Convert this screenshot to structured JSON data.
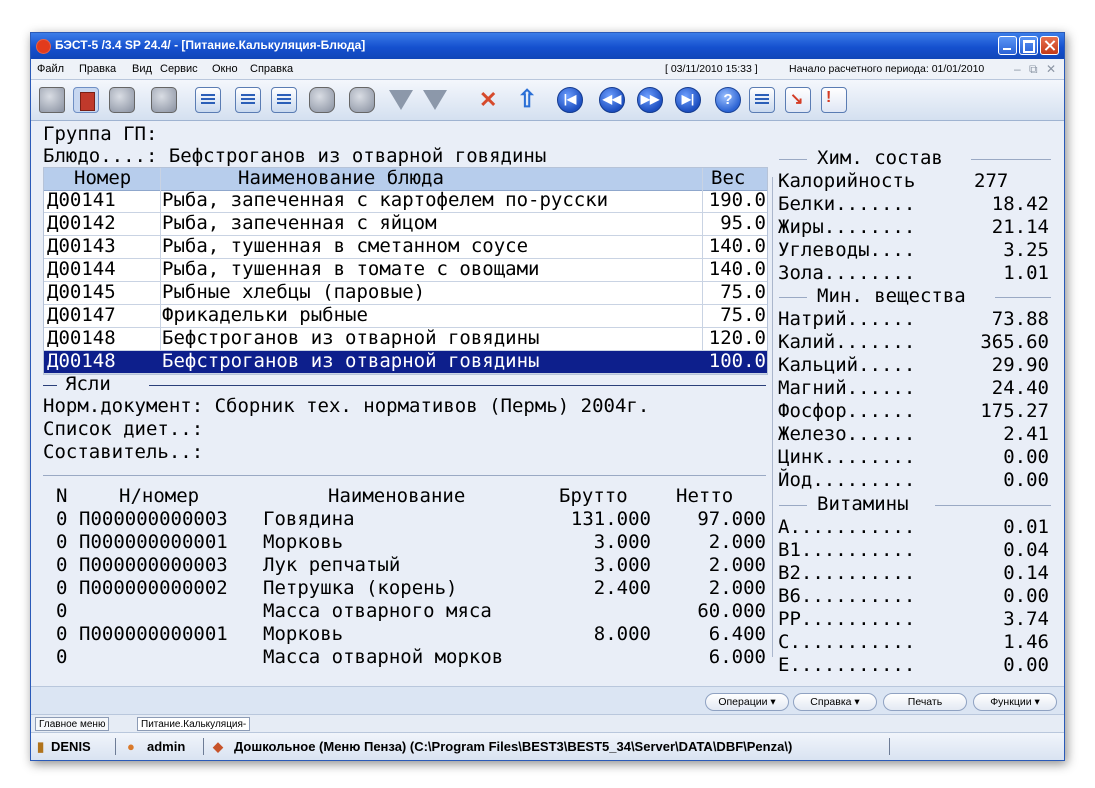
{
  "window": {
    "title": "БЭСТ-5 /3.4 SP 24.4/ - [Питание.Калькуляция-Блюда]"
  },
  "menu": {
    "items": [
      "Файл",
      "Правка",
      "Вид",
      "Сервис",
      "Окно",
      "Справка"
    ],
    "datetime": "[ 03/11/2010 15:33 ]",
    "period": "Начало расчетного периода: 01/01/2010",
    "mdi_controls": [
      "–",
      "⧉",
      "✕"
    ]
  },
  "toolbar": {
    "icons": [
      "book-icon",
      "card-icon",
      "printer-icon",
      "printer-preview-icon",
      "edit-document-icon",
      "add-row-icon",
      "delete-row-icon",
      "binoculars-icon",
      "binoculars-next-icon",
      "filter-icon",
      "filter-dropdown-icon",
      "clear-icon",
      "sort-icon",
      "first-record-icon",
      "previous-record-icon",
      "next-record-icon",
      "last-record-icon",
      "help-icon",
      "list-icon",
      "chart-icon",
      "chart-alert-icon"
    ]
  },
  "header": {
    "group_line": "Группа ГП:",
    "dish_line": "Блюдо....: Бефстроганов из отварной говядины"
  },
  "dishes": {
    "columns": {
      "code": "Номер",
      "name": "Наименование блюда",
      "weight": "Вес"
    },
    "rows": [
      {
        "code": "Д00141",
        "name": "Рыба, запеченная с картофелем по-русски",
        "weight": "190.0"
      },
      {
        "code": "Д00142",
        "name": "Рыба, запеченная с яйцом",
        "weight": "95.0"
      },
      {
        "code": "Д00143",
        "name": "Рыба, тушенная в сметанном соусе",
        "weight": "140.0"
      },
      {
        "code": "Д00144",
        "name": "Рыба, тушенная в томате с овощами",
        "weight": "140.0"
      },
      {
        "code": "Д00145",
        "name": "Рыбные хлебцы (паровые)",
        "weight": "75.0"
      },
      {
        "code": "Д00147",
        "name": "Фрикадельки рыбные",
        "weight": "75.0"
      },
      {
        "code": "Д00148",
        "name": "Бефстроганов из отварной говядины",
        "weight": "120.0"
      },
      {
        "code": "Д00148",
        "name": "Бефстроганов из отварной говядины",
        "weight": "100.0"
      }
    ]
  },
  "nursery": {
    "legend": "Ясли",
    "norm_doc": "Норм.документ: Сборник тех. нормативов (Пермь) 2004г.",
    "diets": "Список диет..:",
    "author": "Составитель..:"
  },
  "ingredients": {
    "columns": {
      "n": "N",
      "code": "Н/номер",
      "name": "Наименование",
      "gross": "Брутто",
      "net": "Нетто"
    },
    "rows": [
      {
        "n": "0",
        "code": "П000000000003",
        "name": "Говядина",
        "gross": "131.000",
        "net": "97.000"
      },
      {
        "n": "0",
        "code": "П000000000001",
        "name": "Морковь",
        "gross": "3.000",
        "net": "2.000"
      },
      {
        "n": "0",
        "code": "П000000000003",
        "name": "Лук репчатый",
        "gross": "3.000",
        "net": "2.000"
      },
      {
        "n": "0",
        "code": "П000000000002",
        "name": "Петрушка (корень)",
        "gross": "2.400",
        "net": "2.000"
      },
      {
        "n": "0",
        "code": "",
        "name": "Масса отварного мяса",
        "gross": "",
        "net": "60.000"
      },
      {
        "n": "0",
        "code": "П000000000001",
        "name": "Морковь",
        "gross": "8.000",
        "net": "6.400"
      },
      {
        "n": "0",
        "code": "",
        "name": "Масса отварной морков",
        "gross": "",
        "net": "6.000"
      }
    ]
  },
  "chem": {
    "legend": "Хим. состав",
    "calorie_label": "Калорийность",
    "calorie_value": "277",
    "items": [
      {
        "label": "Белки.......",
        "value": "18.42"
      },
      {
        "label": "Жиры........",
        "value": "21.14"
      },
      {
        "label": "Углеводы....",
        "value": "3.25"
      },
      {
        "label": "Зола........",
        "value": "1.01"
      }
    ]
  },
  "minerals": {
    "legend": "Мин. вещества",
    "items": [
      {
        "label": "Натрий......",
        "value": "73.88"
      },
      {
        "label": "Калий.......",
        "value": "365.60"
      },
      {
        "label": "Кальций.....",
        "value": "29.90"
      },
      {
        "label": "Магний......",
        "value": "24.40"
      },
      {
        "label": "Фосфор......",
        "value": "175.27"
      },
      {
        "label": "Железо......",
        "value": "2.41"
      },
      {
        "label": "Цинк........",
        "value": "0.00"
      },
      {
        "label": "Йод.........",
        "value": "0.00"
      }
    ]
  },
  "vitamins": {
    "legend": "Витамины",
    "items": [
      {
        "label": "A...........",
        "value": "0.01"
      },
      {
        "label": "B1..........",
        "value": "0.04"
      },
      {
        "label": "B2..........",
        "value": "0.14"
      },
      {
        "label": "B6..........",
        "value": "0.00"
      },
      {
        "label": "PP..........",
        "value": "3.74"
      },
      {
        "label": "C...........",
        "value": "1.46"
      },
      {
        "label": "E...........",
        "value": "0.00"
      }
    ]
  },
  "buttons": {
    "operations": "Операции",
    "help": "Справка",
    "print": "Печать",
    "functions": "Функции"
  },
  "tabs": [
    "Главное меню",
    "Питание.Калькуляция-"
  ],
  "statusbar": {
    "user_db": "DENIS",
    "user": "admin",
    "database": "Дошкольное (Меню Пенза) (C:\\Program Files\\BEST3\\BEST5_34\\Server\\DATA\\DBF\\Penza\\)"
  }
}
